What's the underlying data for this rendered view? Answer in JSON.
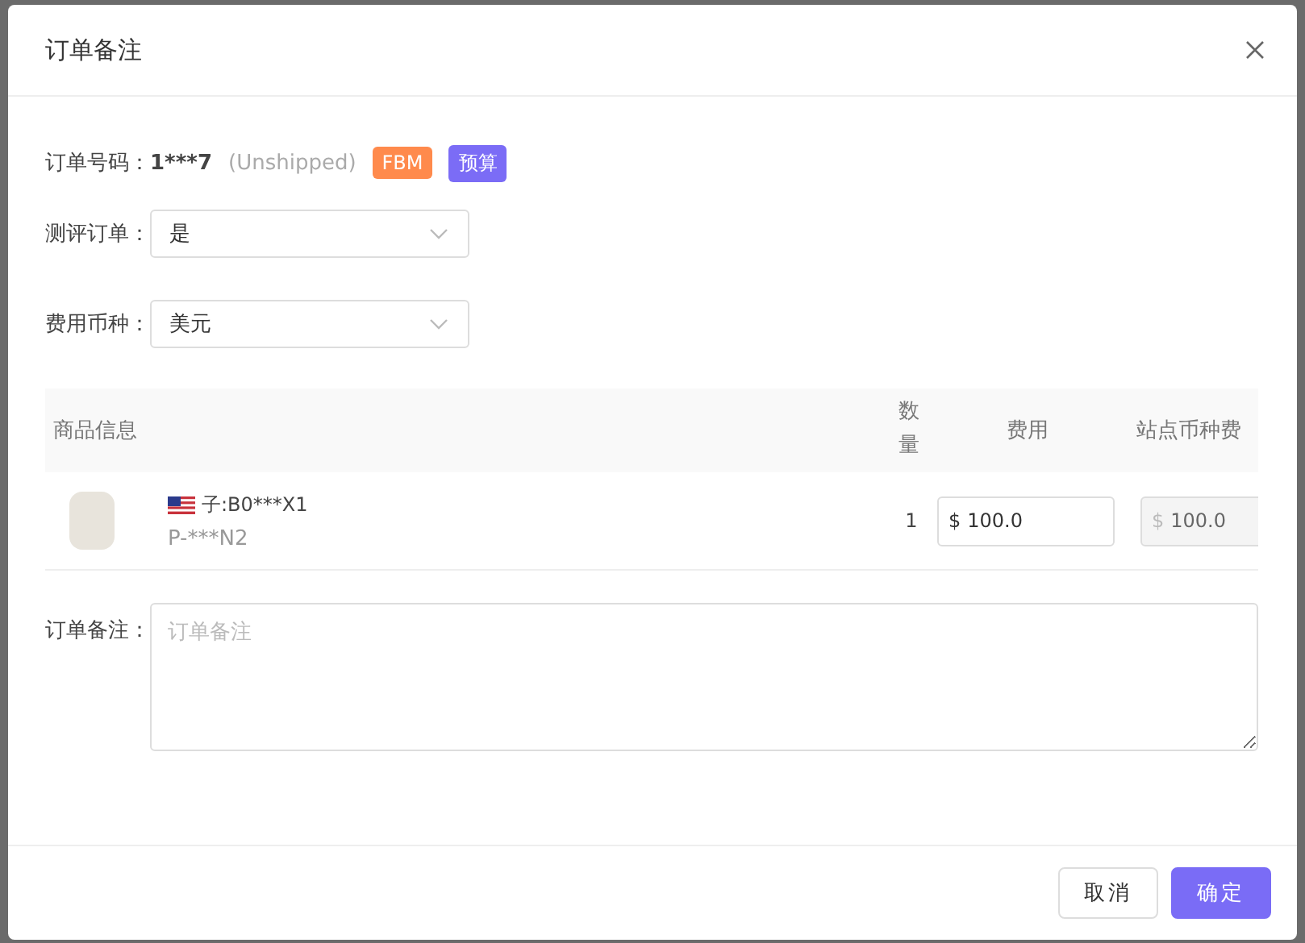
{
  "dialog": {
    "title": "订单备注"
  },
  "order": {
    "label": "订单号码：",
    "number": "1***7",
    "status": "(Unshipped)",
    "tags": [
      {
        "text": "FBM",
        "color": "#ff8a4c"
      },
      {
        "text": "预算",
        "color": "#7b6cf6"
      }
    ]
  },
  "fields": [
    {
      "label": "测评订单：",
      "value": "是"
    },
    {
      "label": "费用币种：",
      "value": "美元"
    }
  ],
  "table": {
    "columns": [
      "商品信息",
      "数量",
      "费用",
      "站点币种费"
    ],
    "rows": [
      {
        "child_asin": "子:B0***X1",
        "sku": "P-***N2",
        "quantity": "1",
        "fee": {
          "prefix": "$",
          "value": "100.0"
        },
        "site_fee": {
          "prefix": "$",
          "value": "100.0",
          "disabled": true
        }
      }
    ]
  },
  "note": {
    "label": "订单备注：",
    "placeholder": "订单备注"
  },
  "buttons": [
    {
      "label": "取消",
      "kind": "default"
    },
    {
      "label": "确定",
      "kind": "primary"
    }
  ]
}
